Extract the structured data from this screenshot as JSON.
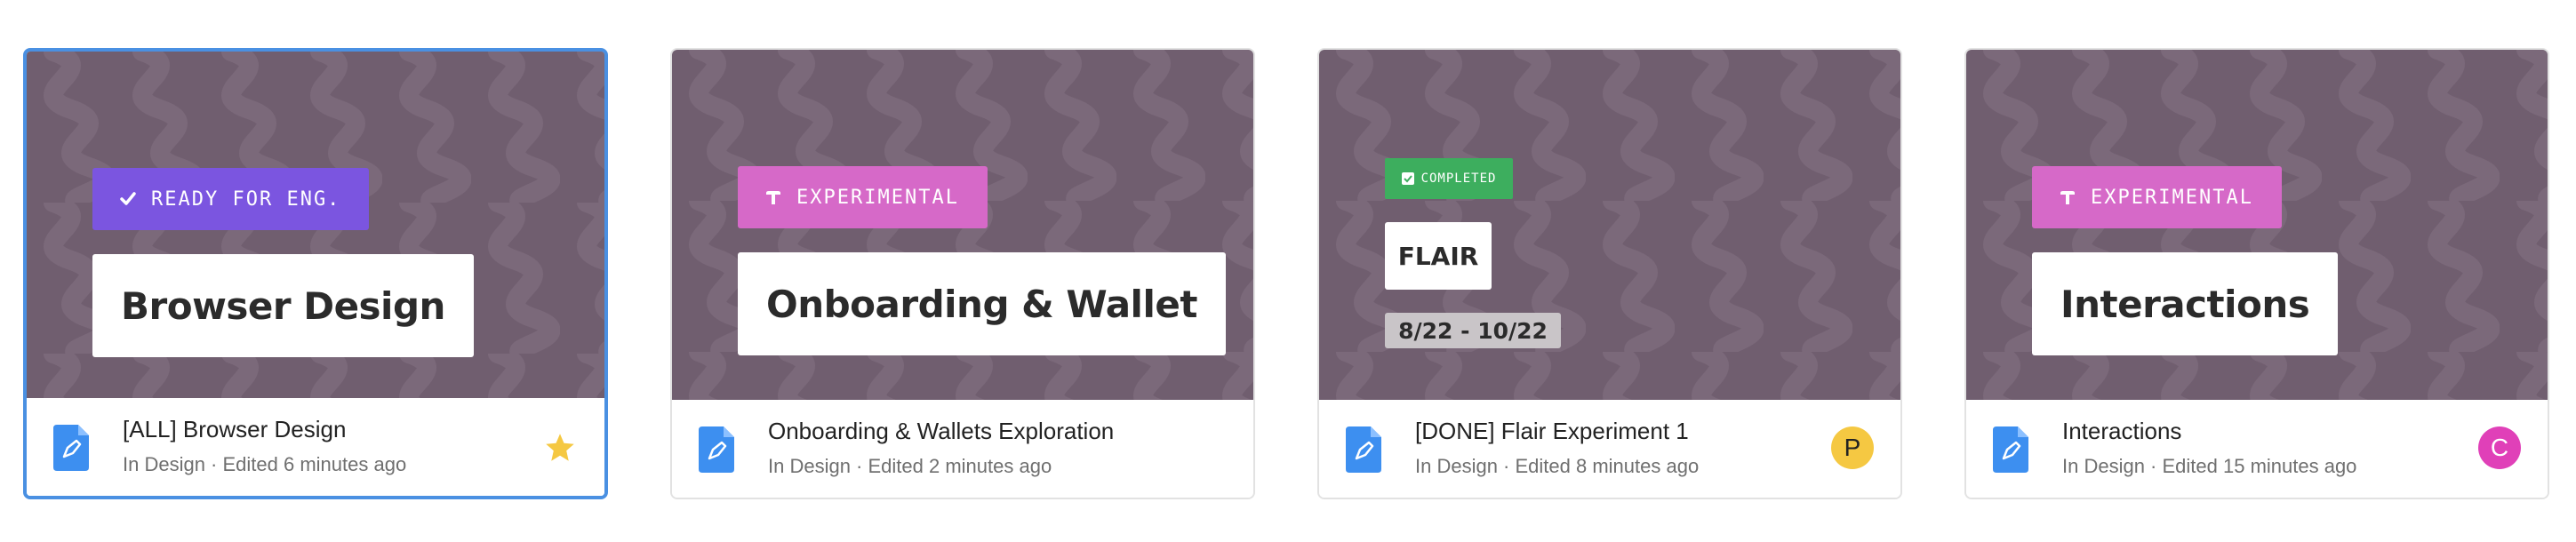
{
  "cards": [
    {
      "tag": {
        "label": "READY FOR ENG.",
        "icon": "check-icon",
        "color": "#7b55e0"
      },
      "thumbnail_title": "Browser Design",
      "file_name": "[ALL] Browser Design",
      "meta": "In Design · Edited 6 minutes ago",
      "starred": true,
      "selected": true
    },
    {
      "tag": {
        "label": "EXPERIMENTAL",
        "icon": "flask-icon",
        "color": "#d669c8"
      },
      "thumbnail_title": "Onboarding & Wallet",
      "file_name": "Onboarding & Wallets Exploration",
      "meta": "In Design · Edited 2 minutes ago"
    },
    {
      "tag": {
        "label": "COMPLETED",
        "icon": "checkbox-icon",
        "color": "#3dae5e"
      },
      "thumbnail_title": "FLAIR",
      "thumbnail_dates": "8/22 - 10/22",
      "file_name": "[DONE] Flair Experiment 1",
      "meta": "In Design · Edited 8 minutes ago",
      "avatar": {
        "initial": "P",
        "color": "#f5c842"
      }
    },
    {
      "tag": {
        "label": "EXPERIMENTAL",
        "icon": "flask-icon",
        "color": "#d669c8"
      },
      "thumbnail_title": "Interactions",
      "file_name": "Interactions",
      "meta": "In Design · Edited 15 minutes ago",
      "avatar": {
        "initial": "C",
        "color": "#e040b8"
      }
    }
  ],
  "thumbnail_background": "#705e6f",
  "file_icon": "design-file-icon",
  "accent": "#4a90e2"
}
